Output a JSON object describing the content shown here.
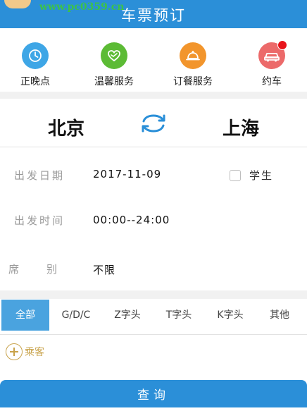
{
  "header": {
    "title": "车票预订",
    "watermark": "www.pc0359.cn"
  },
  "services": [
    {
      "label": "正晚点",
      "icon": "clock-icon",
      "color": "#3ea6e6"
    },
    {
      "label": "温馨服务",
      "icon": "heart-icon",
      "color": "#5cbb35"
    },
    {
      "label": "订餐服务",
      "icon": "food-cloche-icon",
      "color": "#f2952c"
    },
    {
      "label": "约车",
      "icon": "car-icon",
      "color": "#ec6a6a",
      "badge": true
    }
  ],
  "route": {
    "from": "北京",
    "to": "上海",
    "swap_icon": "swap-arrows-icon",
    "accent": "#2a8fd8"
  },
  "form": {
    "date_label": "出发日期",
    "date_value": "2017-11-09",
    "student_label": "学生",
    "time_label": "出发时间",
    "time_value": "00:00--24:00",
    "seat_label": "席　　别",
    "seat_value": "不限"
  },
  "train_types": {
    "tabs": [
      "全部",
      "G/D/C",
      "Z字头",
      "T字头",
      "K字头",
      "其他"
    ],
    "active_index": 0
  },
  "passenger": {
    "label": "乘客",
    "icon": "plus-circle-icon"
  },
  "query_button": {
    "label": "查询"
  }
}
